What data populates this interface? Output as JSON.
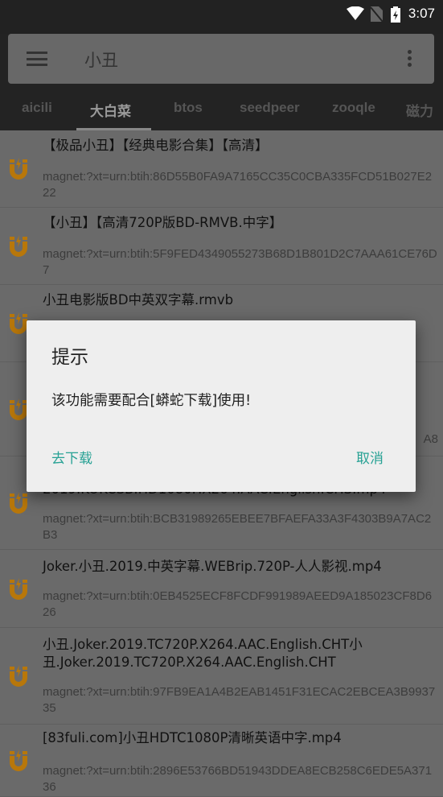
{
  "status_bar": {
    "time": "3:07",
    "icons": [
      "wifi-icon",
      "no-sim-icon",
      "battery-charging-icon"
    ]
  },
  "search": {
    "query": "小丑",
    "menu_icon": "hamburger-icon",
    "more_icon": "more-vert-icon"
  },
  "tabs": [
    {
      "label": "aicili"
    },
    {
      "label": "大白菜",
      "selected": true
    },
    {
      "label": "btos"
    },
    {
      "label": "seedpeer"
    },
    {
      "label": "zooqle"
    },
    {
      "label": "磁力"
    }
  ],
  "results": [
    {
      "title": "【极品小丑】【经典电影合集】【高清】",
      "hash": "magnet:?xt=urn:btih:86D55B0FA9A7165CC35C0CBA335FCD51B027E222"
    },
    {
      "title": "【小丑】【高清720P版BD-RMVB.中字】",
      "hash": "magnet:?xt=urn:btih:5F9FED4349055273B68D1B801D2C7AAA61CE76D7"
    },
    {
      "title": "小丑电影版BD中英双字幕.rmvb",
      "hash": ""
    },
    {
      "title": "",
      "hash": "A8"
    },
    {
      "title": "2019.KOKCSB.HD1080P.X264.AAC.English.CHS.mp4",
      "hash": "magnet:?xt=urn:btih:BCB31989265EBEE7BFAEFA33A3F4303B9A7AC2B3"
    },
    {
      "title": "Joker.小丑.2019.中英字幕.WEBrip.720P-人人影视.mp4",
      "hash": "magnet:?xt=urn:btih:0EB4525ECF8FCDF991989AEED9A185023CF8D626"
    },
    {
      "title": "小丑.Joker.2019.TC720P.X264.AAC.English.CHT小丑.Joker.2019.TC720P.X264.AAC.English.CHT",
      "hash": "magnet:?xt=urn:btih:97FB9EA1A4B2EAB1451F31ECAC2EBCEA3B993735"
    },
    {
      "title": "[83fuli.com]小丑HDTC1080P清晰英语中字.mp4",
      "hash": "magnet:?xt=urn:btih:2896E53766BD51943DDEA8ECB258C6EDE5A37136"
    }
  ],
  "dialog": {
    "title": "提示",
    "message": "该功能需要配合[蟒蛇下载]使用!",
    "confirm": "去下载",
    "cancel": "取消"
  },
  "colors": {
    "accent": "#27a194",
    "magnet_icon": "#b8770a"
  }
}
